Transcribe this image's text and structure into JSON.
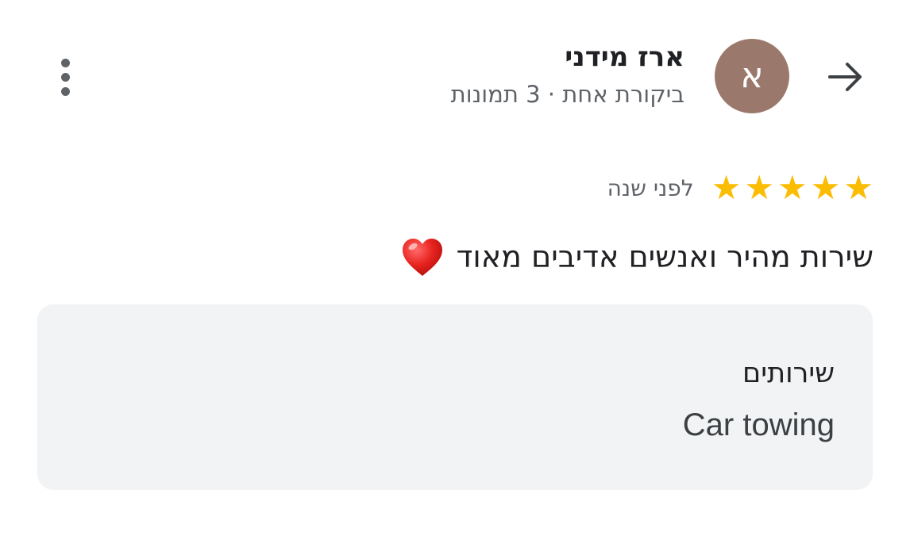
{
  "header": {
    "back_icon": "arrow-right-icon",
    "avatar_letter": "א",
    "avatar_color": "#9b786c",
    "user_name": "ארז מידני",
    "user_meta": "ביקורת אחת · 3 תמונות",
    "more_icon": "more-vert-icon"
  },
  "review": {
    "rating": 5,
    "max_rating": 5,
    "star_color": "#fbbc04",
    "time": "לפני שנה",
    "text": "שירות מהיר ואנשים אדיבים מאוד",
    "emoji": "heart-icon"
  },
  "services": {
    "title": "שירותים",
    "value": "Car towing"
  }
}
